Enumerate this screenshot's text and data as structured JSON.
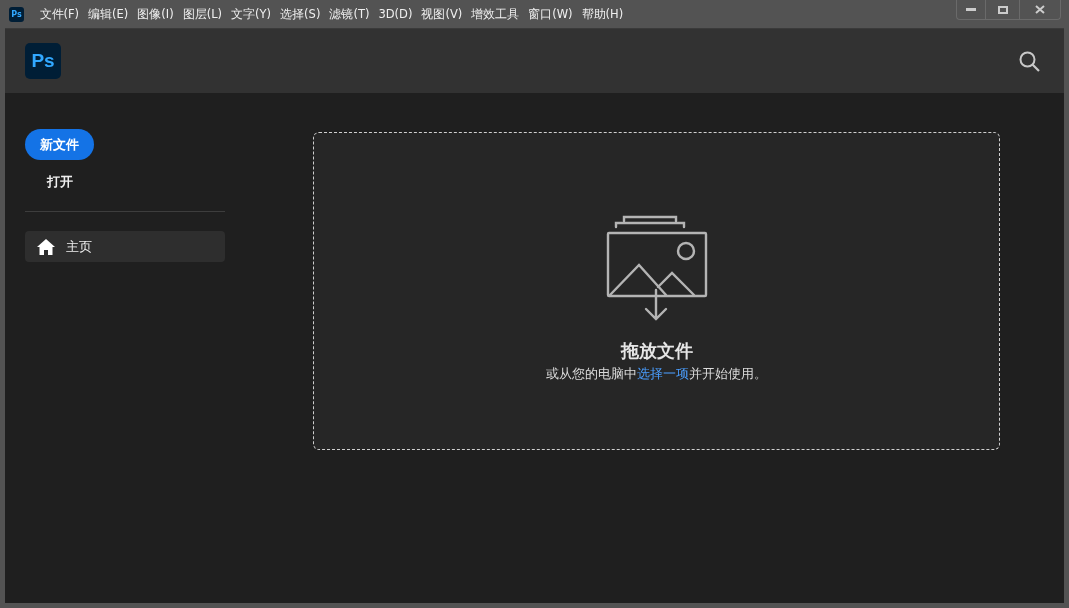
{
  "window": {
    "app_badge": "Ps",
    "menu": [
      "文件(F)",
      "编辑(E)",
      "图像(I)",
      "图层(L)",
      "文字(Y)",
      "选择(S)",
      "滤镜(T)",
      "3D(D)",
      "视图(V)",
      "增效工具",
      "窗口(W)",
      "帮助(H)"
    ]
  },
  "header": {
    "logo": "Ps"
  },
  "sidebar": {
    "actions": [
      {
        "kind": "primary",
        "label": "新文件"
      },
      {
        "kind": "plain",
        "label": "打开"
      }
    ],
    "nav": [
      {
        "label": "主页",
        "selected": true
      }
    ]
  },
  "drop_zone": {
    "title": "拖放文件",
    "text_before": "或从您的电脑中",
    "link": "选择一项",
    "text_after": "并开始使用。"
  }
}
